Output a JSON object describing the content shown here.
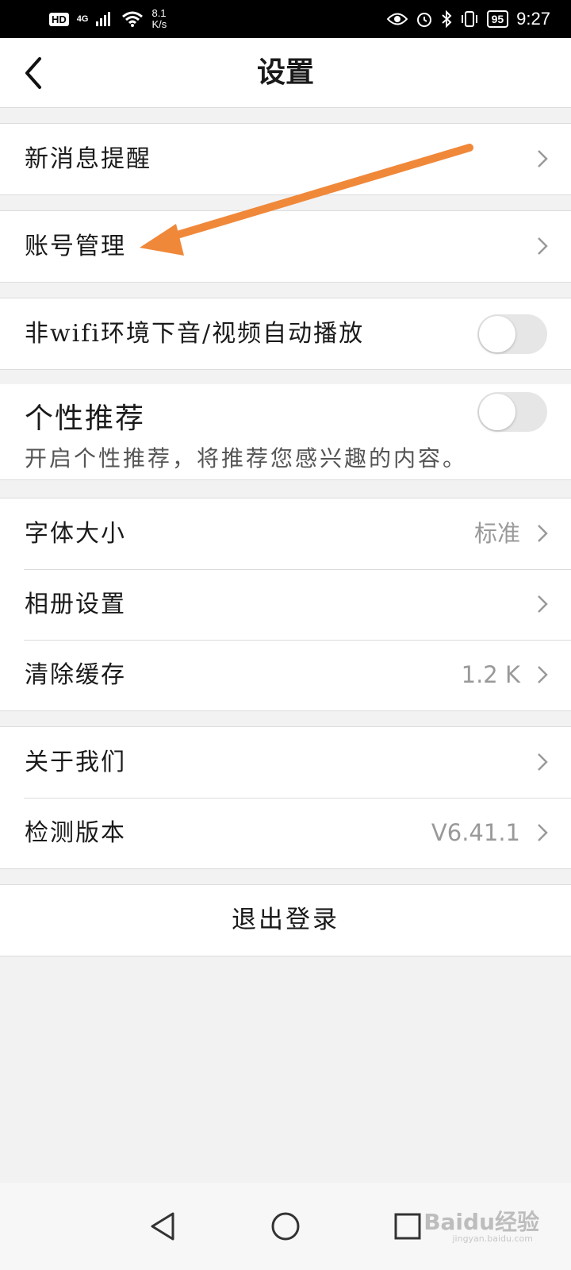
{
  "status_bar": {
    "hd": "HD",
    "network": "4G",
    "speed_value": "8.1",
    "speed_unit": "K/s",
    "battery": "95",
    "time": "9:27"
  },
  "header": {
    "title": "设置"
  },
  "groups": {
    "notifications": {
      "label": "新消息提醒"
    },
    "account": {
      "label": "账号管理"
    },
    "autoplay": {
      "label": "非wifi环境下音/视频自动播放",
      "enabled": false
    },
    "recommend": {
      "title": "个性推荐",
      "description": "开启个性推荐，将推荐您感兴趣的内容。",
      "enabled": false
    },
    "display": {
      "font_size": {
        "label": "字体大小",
        "value": "标准"
      },
      "album": {
        "label": "相册设置"
      },
      "cache": {
        "label": "清除缓存",
        "value": "1.2 K"
      }
    },
    "about": {
      "about_us": {
        "label": "关于我们"
      },
      "version": {
        "label": "检测版本",
        "value": "V6.41.1"
      }
    }
  },
  "logout": {
    "label": "退出登录"
  },
  "annotation": {
    "color": "#f0883a"
  },
  "watermark": {
    "main": "Baidu经验",
    "sub": "jingyan.baidu.com"
  }
}
